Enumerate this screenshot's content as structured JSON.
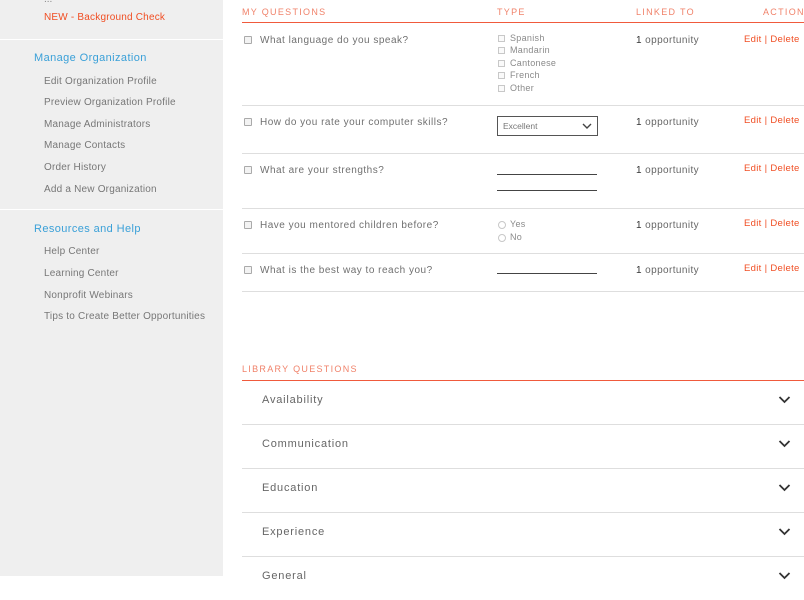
{
  "sidebar": {
    "cropped_top_label": "...",
    "background_check_label": "NEW - Background Check",
    "manage_org": {
      "heading": "Manage Organization",
      "links": [
        "Edit Organization Profile",
        "Preview Organization Profile",
        "Manage Administrators",
        "Manage Contacts",
        "Order History",
        "Add a New Organization"
      ]
    },
    "resources": {
      "heading": "Resources and Help",
      "links": [
        "Help Center",
        "Learning Center",
        "Nonprofit Webinars",
        "Tips to Create Better Opportunities"
      ]
    }
  },
  "my_questions": {
    "section_label": "MY QUESTIONS",
    "columns": {
      "type": "TYPE",
      "linked_to": "LINKED TO",
      "action": "ACTION"
    },
    "rows": [
      {
        "question": "What language do you speak?",
        "type": "checkboxes",
        "options": [
          "Spanish",
          "Mandarin",
          "Cantonese",
          "French",
          "Other"
        ],
        "linked_count": "1",
        "linked_label": "opportunity",
        "edit_label": "Edit",
        "separator": "|",
        "delete_label": "Delete"
      },
      {
        "question": "How do you rate your computer skills?",
        "type": "dropdown",
        "selected": "Excellent",
        "linked_count": "1",
        "linked_label": "opportunity",
        "edit_label": "Edit",
        "separator": "|",
        "delete_label": "Delete"
      },
      {
        "question": "What are your strengths?",
        "type": "text_area",
        "linked_count": "1",
        "linked_label": "opportunity",
        "edit_label": "Edit",
        "separator": "|",
        "delete_label": "Delete"
      },
      {
        "question": "Have you mentored children before?",
        "type": "radio",
        "options": [
          "Yes",
          "No"
        ],
        "linked_count": "1",
        "linked_label": "opportunity",
        "edit_label": "Edit",
        "separator": "|",
        "delete_label": "Delete"
      },
      {
        "question": "What is the best way to reach you?",
        "type": "text_line",
        "linked_count": "1",
        "linked_label": "opportunity",
        "edit_label": "Edit",
        "separator": "|",
        "delete_label": "Delete"
      }
    ]
  },
  "library_questions": {
    "section_label": "LIBRARY QUESTIONS",
    "categories": [
      "Availability",
      "Communication",
      "Education",
      "Experience",
      "General"
    ]
  },
  "colors": {
    "accent": "#f04e23",
    "sidebar_heading": "#3aa0d8",
    "sidebar_bg": "#efefef"
  },
  "icons": {
    "select_arrow": "chevron-down-icon",
    "accordion_toggle": "chevron-down-icon"
  }
}
